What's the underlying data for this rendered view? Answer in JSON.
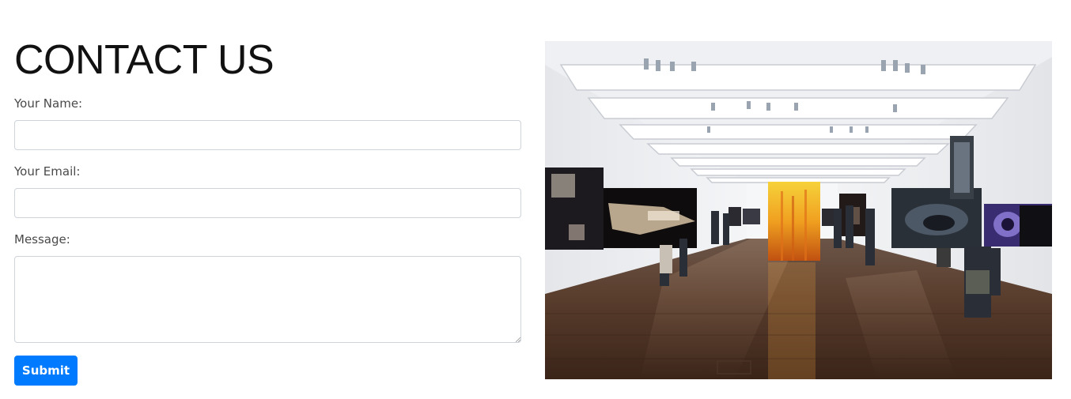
{
  "contact": {
    "title": "CONTACT US",
    "name_label": "Your Name:",
    "name_value": "",
    "email_label": "Your Email:",
    "email_value": "",
    "message_label": "Message:",
    "message_value": "",
    "submit_label": "Submit"
  },
  "colors": {
    "accent": "#007bff",
    "input_border": "#ced4da",
    "label_text": "#4a4a4a"
  }
}
